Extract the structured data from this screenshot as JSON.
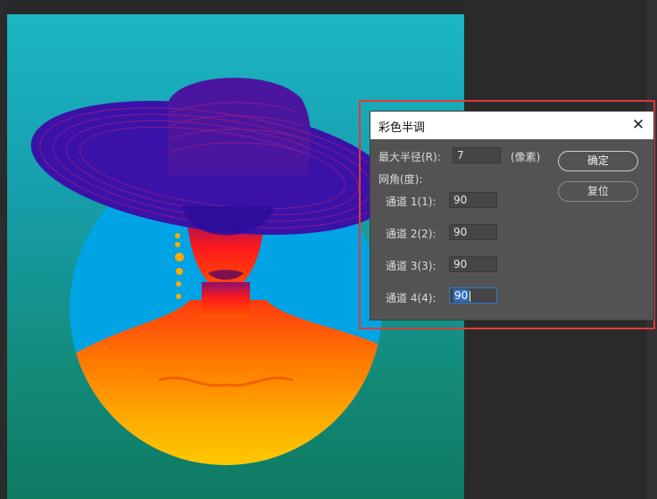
{
  "dialog": {
    "title": "彩色半调",
    "max_radius_label": "最大半径(R):",
    "max_radius_value": "7",
    "unit_label": "(像素)",
    "screen_angles_label": "网角(度):",
    "channels": [
      {
        "label": "通道 1(1):",
        "value": "90"
      },
      {
        "label": "通道 2(2):",
        "value": "90"
      },
      {
        "label": "通道 3(3):",
        "value": "90"
      },
      {
        "label": "通道 4(4):",
        "value": "90"
      }
    ],
    "ok_label": "确定",
    "reset_label": "复位",
    "close_glyph": "✕"
  },
  "colors": {
    "highlight_border": "#e03a3a",
    "dialog_bg": "#535353",
    "input_focus": "#2d7bd0"
  }
}
